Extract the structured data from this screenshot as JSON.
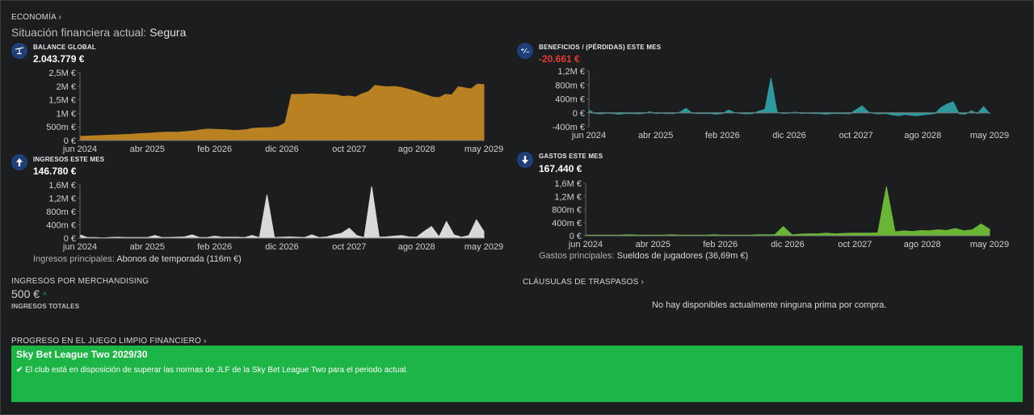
{
  "header": {
    "section_link": "ECONOMÍA",
    "status_label": "Situación financiera actual:",
    "status_value": "Segura"
  },
  "charts": {
    "balance": {
      "title": "BALANCE GLOBAL",
      "value": "2.043.779 €",
      "icon": "scale-icon"
    },
    "profit": {
      "title": "BENEFICIOS / (PÉRDIDAS) ESTE MES",
      "value": "-20.661 €",
      "icon": "plus-minus-icon"
    },
    "income": {
      "title": "INGRESOS ESTE MES",
      "value": "146.780 €",
      "icon": "arrow-up-icon",
      "note_label": "Ingresos principales:",
      "note_value": "Abonos de temporada (116m €)"
    },
    "expenses": {
      "title": "GASTOS ESTE MES",
      "value": "167.440 €",
      "icon": "arrow-down-icon",
      "note_label": "Gastos principales:",
      "note_value": "Sueldos de jugadores (36,69m €)"
    }
  },
  "merchandising": {
    "link": "INGRESOS POR MERCHANDISING",
    "value": "500 €",
    "sublabel": "INGRESOS TOTALES"
  },
  "transfers": {
    "link": "CLÁUSULAS DE TRASPASOS",
    "empty_message": "No hay disponibles actualmente ninguna prima por compra."
  },
  "ffp": {
    "link": "PROGRESO EN EL JUEGO LIMPIO FINANCIERO",
    "competition": "Sky Bet League Two 2029/30",
    "message": "El club está en disposición de superar las normas de JLF de la Sky Bet League Two para el periodo actual."
  },
  "colors": {
    "balance": "#b98122",
    "profit": "#2e9aa0",
    "income": "#d9d9d9",
    "expenses": "#6bb536",
    "ffp_bg": "#1db545",
    "negative": "#e53935"
  },
  "chart_data": [
    {
      "type": "area",
      "title": "BALANCE GLOBAL",
      "x_ticks": [
        "jun 2024",
        "abr 2025",
        "feb 2026",
        "dic 2026",
        "oct 2027",
        "ago 2028",
        "may 2029"
      ],
      "y_ticks": [
        "0 €",
        "500m €",
        "1M €",
        "1,5M €",
        "2M €",
        "2,5M €"
      ],
      "ylim": [
        0,
        2500000
      ],
      "values": [
        150000,
        160000,
        170000,
        180000,
        190000,
        200000,
        210000,
        220000,
        230000,
        250000,
        260000,
        270000,
        290000,
        300000,
        310000,
        300000,
        320000,
        340000,
        360000,
        400000,
        420000,
        410000,
        400000,
        390000,
        370000,
        380000,
        400000,
        450000,
        460000,
        470000,
        480000,
        520000,
        650000,
        1700000,
        1700000,
        1700000,
        1720000,
        1710000,
        1700000,
        1690000,
        1680000,
        1620000,
        1640000,
        1600000,
        1720000,
        1800000,
        2030000,
        2000000,
        1980000,
        1990000,
        1960000,
        1900000,
        1840000,
        1760000,
        1680000,
        1600000,
        1580000,
        1700000,
        1680000,
        1980000,
        1940000,
        1900000,
        2080000,
        2060000
      ]
    },
    {
      "type": "area",
      "title": "BENEFICIOS / (PÉRDIDAS) ESTE MES",
      "x_ticks": [
        "jun 2024",
        "abr 2025",
        "feb 2026",
        "dic 2026",
        "oct 2027",
        "ago 2028",
        "may 2029"
      ],
      "y_ticks": [
        "-400m €",
        "0 €",
        "400m €",
        "800m €",
        "1,2M €"
      ],
      "ylim": [
        -400000,
        1200000
      ],
      "values": [
        80000,
        -20000,
        -30000,
        -10000,
        -20000,
        -40000,
        -20000,
        -20000,
        -30000,
        -20000,
        30000,
        -20000,
        -10000,
        -20000,
        -20000,
        20000,
        130000,
        -10000,
        -20000,
        -20000,
        -20000,
        -40000,
        -20000,
        80000,
        10000,
        -20000,
        -30000,
        -20000,
        50000,
        100000,
        1000000,
        20000,
        -20000,
        -10000,
        20000,
        -20000,
        -10000,
        -20000,
        -20000,
        -40000,
        -20000,
        -20000,
        -20000,
        -30000,
        90000,
        200000,
        30000,
        -20000,
        -30000,
        -20000,
        -60000,
        -80000,
        -50000,
        -70000,
        -80000,
        -60000,
        -40000,
        -20000,
        150000,
        250000,
        320000,
        -30000,
        -40000,
        60000,
        -20000,
        180000,
        -20000
      ]
    },
    {
      "type": "area",
      "title": "INGRESOS ESTE MES",
      "x_ticks": [
        "jun 2024",
        "abr 2025",
        "feb 2026",
        "dic 2026",
        "oct 2027",
        "ago 2028",
        "may 2029"
      ],
      "y_ticks": [
        "0 €",
        "400m €",
        "800m €",
        "1,2M €",
        "1,6M €"
      ],
      "ylim": [
        0,
        1600000
      ],
      "values": [
        100000,
        20000,
        20000,
        10000,
        20000,
        30000,
        20000,
        20000,
        20000,
        20000,
        80000,
        20000,
        20000,
        30000,
        40000,
        100000,
        20000,
        20000,
        60000,
        30000,
        30000,
        30000,
        20000,
        80000,
        20000,
        1300000,
        20000,
        30000,
        40000,
        30000,
        20000,
        100000,
        20000,
        40000,
        100000,
        150000,
        300000,
        80000,
        20000,
        1550000,
        30000,
        40000,
        60000,
        80000,
        40000,
        30000,
        200000,
        350000,
        40000,
        500000,
        100000,
        30000,
        80000,
        550000,
        200000
      ]
    },
    {
      "type": "area",
      "title": "GASTOS ESTE MES",
      "x_ticks": [
        "jun 2024",
        "abr 2025",
        "feb 2026",
        "dic 2026",
        "oct 2027",
        "ago 2028",
        "may 2029"
      ],
      "y_ticks": [
        "0 €",
        "400m €",
        "800m €",
        "1,2M €",
        "1,6M €"
      ],
      "ylim": [
        0,
        1600000
      ],
      "values": [
        20000,
        20000,
        20000,
        20000,
        20000,
        30000,
        20000,
        20000,
        20000,
        20000,
        30000,
        20000,
        20000,
        20000,
        20000,
        30000,
        20000,
        20000,
        20000,
        20000,
        30000,
        30000,
        30000,
        280000,
        30000,
        50000,
        60000,
        60000,
        80000,
        60000,
        70000,
        80000,
        80000,
        80000,
        90000,
        1500000,
        120000,
        150000,
        130000,
        160000,
        150000,
        180000,
        160000,
        220000,
        150000,
        180000,
        360000,
        200000
      ]
    }
  ]
}
